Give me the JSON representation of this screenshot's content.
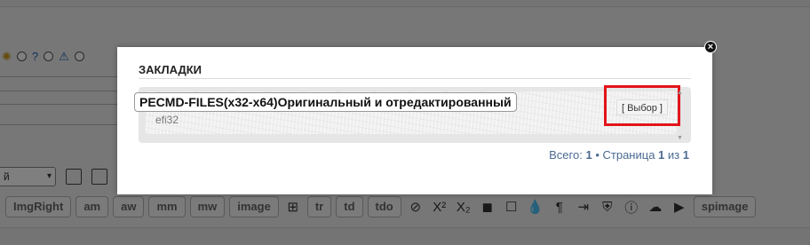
{
  "background": {
    "select_value": "й",
    "select_arrow": "▾",
    "icons": [
      "sun-icon",
      "help-circle-icon",
      "warning-icon"
    ],
    "icon_glyphs": {
      "sun": "✺",
      "help": "?",
      "warn": "⚠"
    },
    "buttons": [
      "ImgRight",
      "am",
      "aw",
      "mm",
      "mw",
      "image"
    ],
    "buttons2": [
      "tr",
      "td",
      "tdo"
    ],
    "symbols": [
      "⊞",
      "⊘",
      "X²",
      "X₂",
      "◼",
      "☐",
      "💧",
      "¶",
      "⇥",
      "⛨",
      "ⓘ",
      "☁",
      "▶"
    ],
    "last_button": "spimage"
  },
  "modal": {
    "close_glyph": "×",
    "title": "ЗАКЛАДКИ",
    "bookmark": {
      "name": "PECMD-FILES(x32-x64)Оригинальный и отредактированный",
      "sub": "efi32",
      "choose_label": "[ Выбор ]"
    },
    "pager": {
      "total_label": "Всего:",
      "total": "1",
      "sep": "•",
      "page_label": "Страница",
      "page": "1",
      "of_label": "из",
      "pages": "1"
    }
  },
  "colors": {
    "highlight": "#e2141b",
    "pager": "#4b6a93"
  }
}
